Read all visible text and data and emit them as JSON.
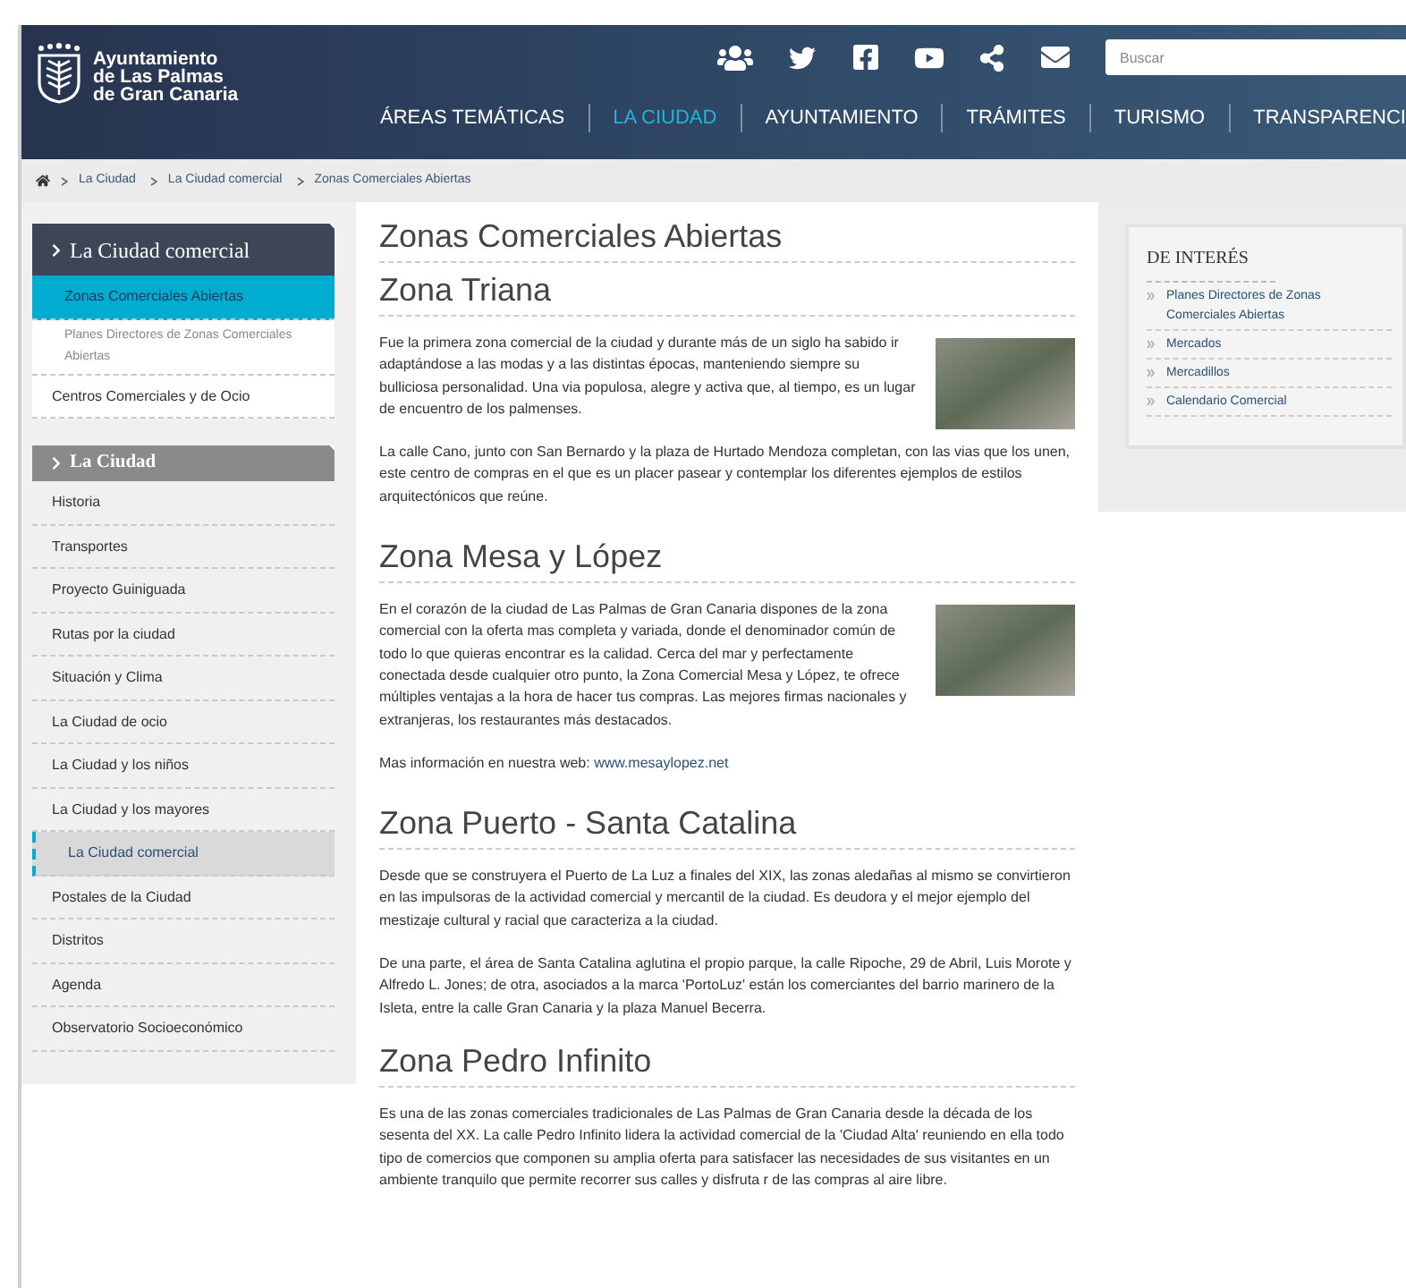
{
  "header": {
    "logo_lines": [
      "Ayuntamiento",
      "de Las Palmas",
      "de Gran Canaria"
    ],
    "search": {
      "placeholder": "Buscar"
    },
    "nav": [
      {
        "label": "ÁREAS TEMÁTICAS",
        "selected": false
      },
      {
        "label": "LA CIUDAD",
        "selected": true
      },
      {
        "label": "AYUNTAMIENTO",
        "selected": false
      },
      {
        "label": "TRÁMITES",
        "selected": false
      },
      {
        "label": "TURISMO",
        "selected": false
      },
      {
        "label": "TRANSPARENCI",
        "selected": false
      }
    ]
  },
  "breadcrumb": [
    "La Ciudad",
    "La Ciudad comercial",
    "Zonas Comerciales Abiertas"
  ],
  "sidebar": {
    "sections": [
      {
        "title": "La Ciudad comercial",
        "kind": "dark",
        "items": [
          {
            "label": "Zonas Comerciales Abiertas",
            "selected": true,
            "children": [
              {
                "label": "Planes Directores de Zonas Comerciales Abiertas",
                "selected": false
              }
            ]
          },
          {
            "label": "Centros Comerciales y de Ocio",
            "selected": false
          }
        ]
      },
      {
        "title": "La Ciudad",
        "kind": "grey",
        "items": [
          {
            "label": "Historia",
            "selected": false
          },
          {
            "label": "Transportes",
            "selected": false
          },
          {
            "label": "Proyecto Guiniguada",
            "selected": false
          },
          {
            "label": "Rutas por la ciudad",
            "selected": false
          },
          {
            "label": "Situación y Clima",
            "selected": false
          },
          {
            "label": "La Ciudad de ocio",
            "selected": false
          },
          {
            "label": "La Ciudad y los niños",
            "selected": false
          },
          {
            "label": "La Ciudad y los mayores",
            "selected": false
          },
          {
            "label": "La Ciudad comercial",
            "selected": true
          },
          {
            "label": "Postales de la Ciudad",
            "selected": false
          },
          {
            "label": "Distritos",
            "selected": false
          },
          {
            "label": "Agenda",
            "selected": false
          },
          {
            "label": "Observatorio Socioeconómico",
            "selected": false
          }
        ]
      }
    ]
  },
  "main": {
    "title": "Zonas Comerciales Abiertas",
    "sections": [
      {
        "heading": "Zona Triana",
        "photo": true,
        "paragraphs": [
          {
            "text": "Fue la primera zona comercial de la ciudad y durante más de un siglo ha sabido ir adaptándose a las modas y a las distintas épocas, manteniendo siempre su bulliciosa personalidad. Una via populosa, alegre y activa que, al tiempo, es un lugar de encuentro de los palmenses."
          },
          {
            "text": "La calle Cano, junto con San Bernardo y la plaza de Hurtado Mendoza completan, con las vias que los unen, este centro de compras en el que es un placer pasear y contemplar los diferentes ejemplos de estilos arquitectónicos que reúne."
          }
        ]
      },
      {
        "heading": "Zona Mesa y López",
        "photo": true,
        "paragraphs": [
          {
            "text": "En el corazón de la ciudad de Las Palmas de Gran Canaria dispones de la zona comercial con la oferta mas completa y variada, donde el denominador común de todo lo que quieras encontrar es la calidad. Cerca del mar y perfectamente conectada desde cualquier otro punto, la Zona Comercial Mesa y López, te ofrece múltiples ventajas a la hora de hacer tus compras. Las mejores firmas nacionales y extranjeras, los restaurantes más destacados."
          },
          {
            "text": "Mas información en nuestra web: ",
            "link": "www.mesaylopez.net"
          }
        ]
      },
      {
        "heading": "Zona Puerto - Santa Catalina",
        "photo": false,
        "paragraphs": [
          {
            "text": "Desde que se construyera el Puerto de La Luz a finales del XIX, las zonas aledañas al mismo se convirtieron en las impulsoras de la actividad comercial y mercantil de la ciudad. Es deudora y el mejor ejemplo del mestizaje cultural y racial que caracteriza a la ciudad."
          },
          {
            "text": "De una parte, el área de Santa Catalina aglutina el propio parque, la calle Ripoche, 29 de Abril, Luis Morote y Alfredo L. Jones; de otra, asociados a la marca 'PortoLuz' están los comerciantes del barrio marinero de la Isleta, entre la calle Gran Canaria y la plaza Manuel Becerra."
          }
        ]
      },
      {
        "heading": "Zona Pedro Infinito",
        "photo": false,
        "paragraphs": [
          {
            "text": "Es una de las zonas comerciales tradicionales de Las Palmas de Gran Canaria desde la década de los sesenta del XX. La calle Pedro Infinito lidera la actividad comercial de la 'Ciudad Alta' reuniendo en ella todo tipo de comercios que componen su amplia oferta para satisfacer las necesidades de sus visitantes en un ambiente tranquilo que permite recorrer sus calles y disfruta r de las compras al aire libre."
          }
        ]
      }
    ]
  },
  "aside": {
    "title": "DE INTERÉS",
    "links": [
      "Planes Directores de Zonas Comerciales Abiertas",
      "Mercados",
      "Mercadillos",
      "Calendario Comercial"
    ]
  }
}
